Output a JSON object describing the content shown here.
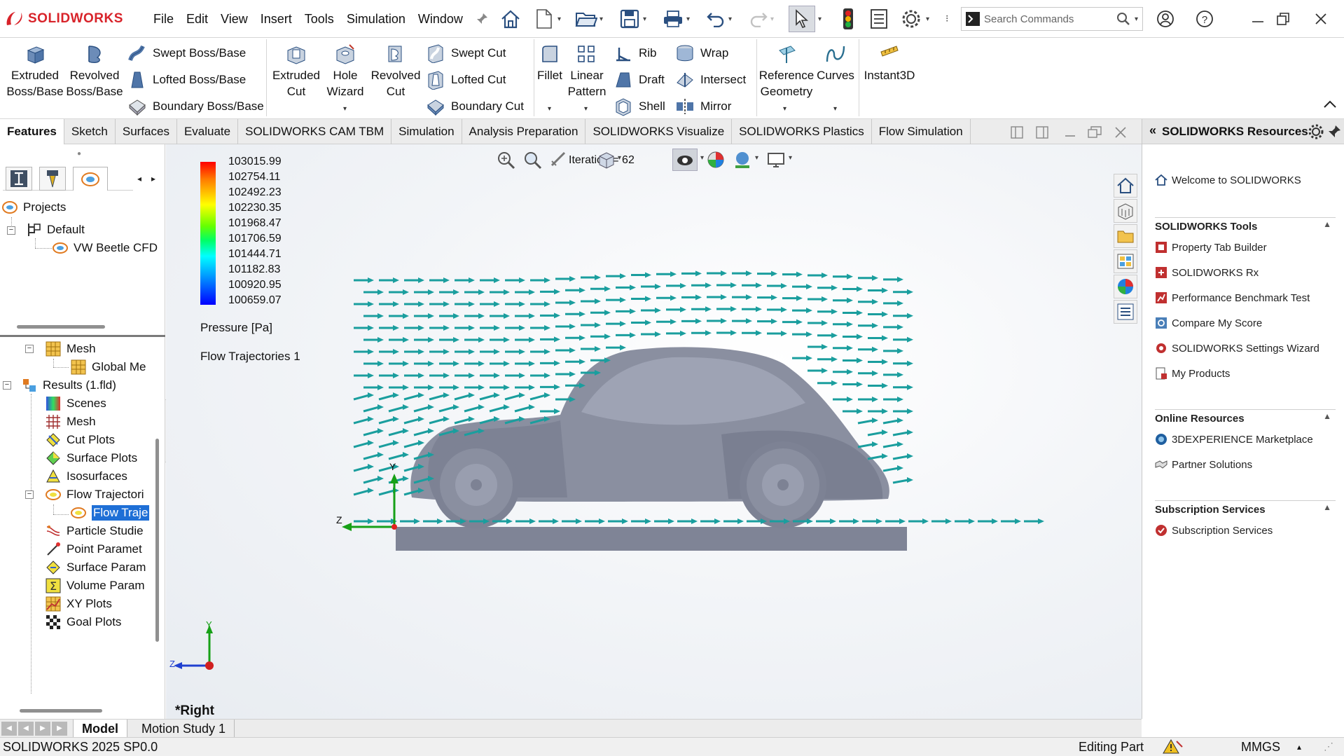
{
  "app": {
    "name": "SOLIDWORKS"
  },
  "menu": [
    "File",
    "Edit",
    "View",
    "Insert",
    "Tools",
    "Simulation",
    "Window"
  ],
  "search": {
    "placeholder": "Search Commands"
  },
  "ribbon": {
    "extruded_boss": [
      "Extruded",
      "Boss/Base"
    ],
    "revolved_boss": [
      "Revolved",
      "Boss/Base"
    ],
    "swept_boss": "Swept Boss/Base",
    "lofted_boss": "Lofted Boss/Base",
    "boundary_boss": "Boundary Boss/Base",
    "extruded_cut": [
      "Extruded",
      "Cut"
    ],
    "hole_wizard": [
      "Hole",
      "Wizard"
    ],
    "revolved_cut": [
      "Revolved",
      "Cut"
    ],
    "swept_cut": "Swept Cut",
    "lofted_cut": "Lofted Cut",
    "boundary_cut": "Boundary Cut",
    "fillet": "Fillet",
    "linear_pattern": [
      "Linear",
      "Pattern"
    ],
    "rib": "Rib",
    "draft": "Draft",
    "shell": "Shell",
    "wrap": "Wrap",
    "intersect": "Intersect",
    "mirror": "Mirror",
    "reference_geometry": [
      "Reference",
      "Geometry"
    ],
    "curves": "Curves",
    "instant3d": "Instant3D"
  },
  "tabs": [
    "Features",
    "Sketch",
    "Surfaces",
    "Evaluate",
    "SOLIDWORKS CAM TBM",
    "Simulation",
    "Analysis Preparation",
    "SOLIDWORKS Visualize",
    "SOLIDWORKS Plastics",
    "Flow Simulation"
  ],
  "tree_top": {
    "projects": "Projects",
    "default": "Default",
    "project": "VW Beetle CFD"
  },
  "tree": [
    "Mesh",
    "Global Me",
    "Results (1.fld)",
    "Scenes",
    "Mesh",
    "Cut Plots",
    "Surface Plots",
    "Isosurfaces",
    "Flow Trajectori",
    "Flow Traje",
    "Particle Studie",
    "Point Paramet",
    "Surface Param",
    "Volume Param",
    "XY Plots",
    "Goal Plots"
  ],
  "viewport": {
    "iteration": "Iteration = 62",
    "legend_values": [
      "103015.99",
      "102754.11",
      "102492.23",
      "102230.35",
      "101968.47",
      "101706.59",
      "101444.71",
      "101182.83",
      "100920.95",
      "100659.07"
    ],
    "legend_title": "Pressure [Pa]",
    "plot_name": "Flow Trajectories 1",
    "view_name": "*Right",
    "axis_y": "Y",
    "axis_z": "Z"
  },
  "right_panel": {
    "title": "SOLIDWORKS Resources",
    "welcome": "Welcome to SOLIDWORKS",
    "sections": [
      {
        "title": "SOLIDWORKS Tools",
        "items": [
          "Property Tab Builder",
          "SOLIDWORKS Rx",
          "Performance Benchmark Test",
          "Compare My Score",
          "SOLIDWORKS Settings Wizard",
          "My Products"
        ]
      },
      {
        "title": "Online Resources",
        "items": [
          "3DEXPERIENCE Marketplace",
          "Partner Solutions"
        ]
      },
      {
        "title": "Subscription Services",
        "items": [
          "Subscription Services"
        ]
      }
    ]
  },
  "bottom_tabs": [
    "Model",
    "Motion Study 1"
  ],
  "status": {
    "version": "SOLIDWORKS 2025 SP0.0",
    "mode": "Editing Part",
    "units": "MMGS"
  },
  "colors": {
    "brand": "#d8232a",
    "arrow": "#1a9e9e",
    "car": "#8a8fa0",
    "platform": "#7f8496"
  }
}
